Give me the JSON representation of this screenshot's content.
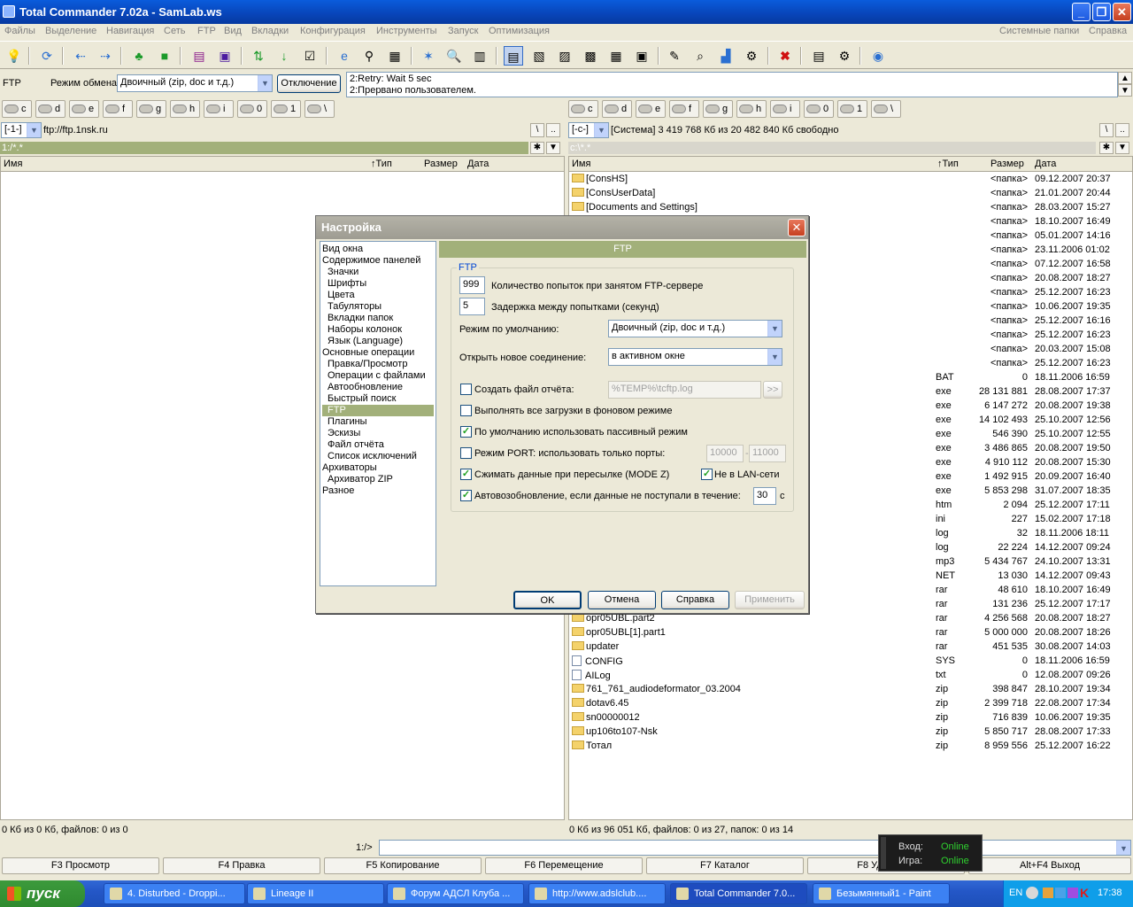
{
  "window": {
    "title": "Total Commander 7.02a - SamLab.ws"
  },
  "menu": {
    "items": [
      "Файлы",
      "Выделение",
      "Навигация",
      "Сеть",
      "FTP",
      "Вид",
      "Вкладки",
      "Конфигурация",
      "Инструменты",
      "Запуск",
      "Оптимизация"
    ],
    "right": [
      "Системные папки",
      "Справка"
    ]
  },
  "ftpbar": {
    "label": "FTP",
    "mode_label": "Режим обмена",
    "mode_value": "Двоичный (zip, doc и т.д.)",
    "disconnect": "Отключение",
    "log": [
      "2:Retry: Wait 5 sec",
      "2:Прервано пользователем."
    ]
  },
  "left": {
    "drives": [
      "c",
      "d",
      "e",
      "f",
      "g",
      "h",
      "i",
      "0",
      "1",
      "\\"
    ],
    "drive_combo": "[-1-]",
    "path": "ftp://ftp.1nsk.ru",
    "filter": "1:/*.*",
    "col_name": "Имя",
    "col_type": "↑Тип",
    "col_size": "Размер",
    "col_date": "Дата",
    "status": "0 Кб из 0 Кб, файлов: 0 из 0"
  },
  "right": {
    "drives": [
      "c",
      "d",
      "e",
      "f",
      "g",
      "h",
      "i",
      "0",
      "1",
      "\\"
    ],
    "drive_combo": "[-c-]",
    "disk_info": "[Система]  3 419 768 Кб из 20 482 840 Кб свободно",
    "filter": "c:\\*.*",
    "col_name": "Имя",
    "col_type": "↑Тип",
    "col_size": "Размер",
    "col_date": "Дата",
    "status": "0 Кб из 96 051 Кб, файлов: 0 из 27, папок: 0 из 14",
    "rows": [
      {
        "name": "[ConsHS]",
        "ext": "",
        "size": "<папка>",
        "date": "09.12.2007 20:37",
        "icon": "folder"
      },
      {
        "name": "[ConsUserData]",
        "ext": "",
        "size": "<папка>",
        "date": "21.01.2007 20:44",
        "icon": "folder"
      },
      {
        "name": "[Documents and Settings]",
        "ext": "",
        "size": "<папка>",
        "date": "28.03.2007 15:27",
        "icon": "folder"
      },
      {
        "name": "",
        "ext": "",
        "size": "<папка>",
        "date": "18.10.2007 16:49",
        "icon": ""
      },
      {
        "name": "",
        "ext": "",
        "size": "<папка>",
        "date": "05.01.2007 14:16",
        "icon": ""
      },
      {
        "name": "",
        "ext": "",
        "size": "<папка>",
        "date": "23.11.2006 01:02",
        "icon": ""
      },
      {
        "name": "",
        "ext": "",
        "size": "<папка>",
        "date": "07.12.2007 16:58",
        "icon": ""
      },
      {
        "name": "",
        "ext": "",
        "size": "<папка>",
        "date": "20.08.2007 18:27",
        "icon": ""
      },
      {
        "name": "",
        "ext": "",
        "size": "<папка>",
        "date": "25.12.2007 16:23",
        "icon": ""
      },
      {
        "name": "",
        "ext": "",
        "size": "<папка>",
        "date": "10.06.2007 19:35",
        "icon": ""
      },
      {
        "name": "",
        "ext": "",
        "size": "<папка>",
        "date": "25.12.2007 16:16",
        "icon": ""
      },
      {
        "name": "",
        "ext": "",
        "size": "<папка>",
        "date": "25.12.2007 16:23",
        "icon": ""
      },
      {
        "name": "",
        "ext": "",
        "size": "<папка>",
        "date": "20.03.2007 15:08",
        "icon": ""
      },
      {
        "name": "",
        "ext": "",
        "size": "<папка>",
        "date": "25.12.2007 16:23",
        "icon": ""
      },
      {
        "name": "",
        "ext": "BAT",
        "size": "0",
        "date": "18.11.2006 16:59",
        "icon": ""
      },
      {
        "name": "",
        "ext": "exe",
        "size": "28 131 881",
        "date": "28.08.2007 17:37",
        "icon": ""
      },
      {
        "name": "",
        "ext": "exe",
        "size": "6 147 272",
        "date": "20.08.2007 19:38",
        "icon": ""
      },
      {
        "name": "",
        "ext": "exe",
        "size": "14 102 493",
        "date": "25.10.2007 12:56",
        "icon": ""
      },
      {
        "name": "",
        "ext": "exe",
        "size": "546 390",
        "date": "25.10.2007 12:55",
        "icon": ""
      },
      {
        "name": "",
        "ext": "exe",
        "size": "3 486 865",
        "date": "20.08.2007 19:50",
        "icon": ""
      },
      {
        "name": "",
        "ext": "exe",
        "size": "4 910 112",
        "date": "20.08.2007 15:30",
        "icon": ""
      },
      {
        "name": "",
        "ext": "exe",
        "size": "1 492 915",
        "date": "20.09.2007 16:40",
        "icon": ""
      },
      {
        "name": "",
        "ext": "exe",
        "size": "5 853 298",
        "date": "31.07.2007 18:35",
        "icon": ""
      },
      {
        "name": "",
        "ext": "htm",
        "size": "2 094",
        "date": "25.12.2007 17:11",
        "icon": ""
      },
      {
        "name": "",
        "ext": "ini",
        "size": "227",
        "date": "15.02.2007 17:18",
        "icon": ""
      },
      {
        "name": "",
        "ext": "log",
        "size": "32",
        "date": "18.11.2006 18:11",
        "icon": ""
      },
      {
        "name": "",
        "ext": "log",
        "size": "22 224",
        "date": "14.12.2007 09:24",
        "icon": ""
      },
      {
        "name": "",
        "ext": "mp3",
        "size": "5 434 767",
        "date": "24.10.2007 13:31",
        "icon": ""
      },
      {
        "name": "",
        "ext": "NET",
        "size": "13 030",
        "date": "14.12.2007 09:43",
        "icon": ""
      },
      {
        "name": "",
        "ext": "rar",
        "size": "48 610",
        "date": "18.10.2007 16:49",
        "icon": ""
      },
      {
        "name": "",
        "ext": "rar",
        "size": "131 236",
        "date": "25.12.2007 17:17",
        "icon": ""
      },
      {
        "name": "opr05UBL.part2",
        "ext": "rar",
        "size": "4 256 568",
        "date": "20.08.2007 18:27",
        "icon": "folder"
      },
      {
        "name": "opr05UBL[1].part1",
        "ext": "rar",
        "size": "5 000 000",
        "date": "20.08.2007 18:26",
        "icon": "folder"
      },
      {
        "name": "updater",
        "ext": "rar",
        "size": "451 535",
        "date": "30.08.2007 14:03",
        "icon": "folder"
      },
      {
        "name": "CONFIG",
        "ext": "SYS",
        "size": "0",
        "date": "18.11.2006 16:59",
        "icon": "doc"
      },
      {
        "name": "AILog",
        "ext": "txt",
        "size": "0",
        "date": "12.08.2007 09:26",
        "icon": "doc"
      },
      {
        "name": "761_761_audiodeformator_03.2004",
        "ext": "zip",
        "size": "398 847",
        "date": "28.10.2007 19:34",
        "icon": "folder"
      },
      {
        "name": "dotav6.45",
        "ext": "zip",
        "size": "2 399 718",
        "date": "22.08.2007 17:34",
        "icon": "folder"
      },
      {
        "name": "sn00000012",
        "ext": "zip",
        "size": "716 839",
        "date": "10.06.2007 19:35",
        "icon": "folder"
      },
      {
        "name": "up106to107-Nsk",
        "ext": "zip",
        "size": "5 850 717",
        "date": "28.08.2007 17:33",
        "icon": "folder"
      },
      {
        "name": "Тотал",
        "ext": "zip",
        "size": "8 959 556",
        "date": "25.12.2007 16:22",
        "icon": "folder"
      }
    ]
  },
  "cmdline": {
    "prompt": "1:/>"
  },
  "fkeys": [
    "F3 Просмотр",
    "F4 Правка",
    "F5 Копирование",
    "F6 Перемещение",
    "F7 Каталог",
    "F8 Удаление",
    "Alt+F4 Выход"
  ],
  "game": {
    "login_label": "Вход:",
    "login_value": "Online",
    "game_label": "Игра:",
    "game_value": "Online"
  },
  "taskbar": {
    "start": "пуск",
    "tasks": [
      "4. Disturbed - Droppi...",
      "Lineage II",
      "Форум АДСЛ Клуба ...",
      "http://www.adslclub....",
      "Total Commander 7.0...",
      "Безымянный1 - Paint"
    ],
    "lang": "EN",
    "clock": "17:38"
  },
  "dialog": {
    "title": "Настройка",
    "panel_title": "FTP",
    "group": "FTP",
    "tree": [
      "Вид окна",
      "Содержимое панелей",
      "Значки",
      "Шрифты",
      "Цвета",
      "Табуляторы",
      "Вкладки папок",
      "Наборы колонок",
      "Язык (Language)",
      "Основные операции",
      "Правка/Просмотр",
      "Операции с файлами",
      "Автообновление",
      "Быстрый поиск",
      "FTP",
      "Плагины",
      "Эскизы",
      "Файл отчёта",
      "Список исключений",
      "Архиваторы",
      "Архиватор ZIP",
      "Разное"
    ],
    "retries_value": "999",
    "retries_label": "Количество попыток при занятом FTP-сервере",
    "delay_value": "5",
    "delay_label": "Задержка между попытками (секунд)",
    "mode_label": "Режим по умолчанию:",
    "mode_value": "Двоичный (zip, doc и т.д.)",
    "open_label": "Открыть новое соединение:",
    "open_value": "в активном окне",
    "log_label": "Создать файл отчёта:",
    "log_value": "%TEMP%\\tcftp.log",
    "log_browse": ">>",
    "bg_label": "Выполнять все загрузки в фоновом режиме",
    "passive_label": "По умолчанию использовать пассивный режим",
    "port_label": "Режим PORT: использовать только порты:",
    "port_from": "10000",
    "port_dash": "-",
    "port_to": "11000",
    "compress_label": "Сжимать данные при пересылке (MODE Z)",
    "nolan_label": "Не в LAN-сети",
    "auto_label": "Автовозобновление, если данные не поступали в течение:",
    "auto_value": "30",
    "auto_unit": "с",
    "checks": {
      "log": false,
      "bg": false,
      "passive": true,
      "port": false,
      "compress": true,
      "nolan": true,
      "auto": true
    },
    "ok": "OK",
    "cancel": "Отмена",
    "help": "Справка",
    "apply": "Применить"
  }
}
